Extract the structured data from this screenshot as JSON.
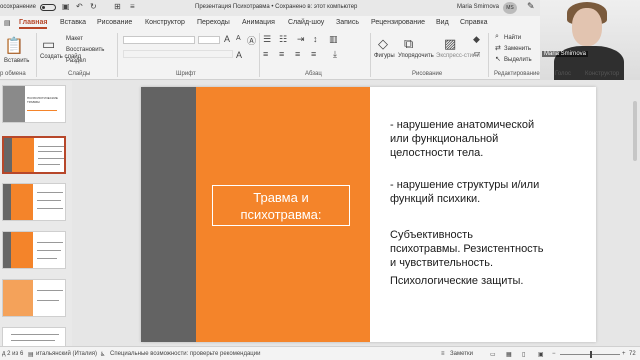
{
  "titlebar": {
    "autosave": "осохранение",
    "title": "Презентация Психотравма • Сохранено в: этот компьютер",
    "user_name": "Maria Smirnova",
    "user_initials": "MS"
  },
  "tabs": [
    "Главная",
    "Вставка",
    "Рисование",
    "Конструктор",
    "Переходы",
    "Анимация",
    "Слайд-шоу",
    "Запись",
    "Рецензирование",
    "Вид",
    "Справка"
  ],
  "ribbon": {
    "paste_label": "Вставить",
    "clipboard_label": "р обмена",
    "new_slide": "Создать слайд",
    "layout": "Макет",
    "reset": "Восстановить",
    "section": "Раздел",
    "slides_group": "Слайды",
    "font_group": "Шрифт",
    "paragraph_group": "Абзац",
    "shapes": "Фигуры",
    "arrange": "Упорядочить",
    "express": "Экспресс-стили",
    "drawing_group": "Рисование",
    "find": "Найти",
    "replace": "Заменить",
    "select": "Выделить",
    "editing_group": "Редактирование",
    "voice_group": "Голос",
    "designer_group": "Конструктор"
  },
  "video": {
    "name": "Maria Smirnova"
  },
  "thumbnails": {
    "slide1_title": "ПСИХОЛОГИЧЕСКИЕ ТРАВМЫ"
  },
  "slide": {
    "title_line1": "Травма и",
    "title_line2": "психотравма:",
    "p1_line1": "- нарушение анатомической",
    "p1_line2": "или функциональной",
    "p1_line3": "целостности тела.",
    "p2_line1": "- нарушение структуры и/или",
    "p2_line2": "функций психики.",
    "p3_line1": "Субъективность",
    "p3_line2": "психотравмы. Резистентность",
    "p3_line3": "и чувствительность.",
    "p4": "Психологические защиты."
  },
  "status": {
    "slide_count": "д 2 из 6",
    "language": "итальянский (Италия)",
    "accessibility": "Специальные возможности: проверьте рекомендации",
    "notes": "Заметки",
    "zoom": "72"
  },
  "colors": {
    "accent": "#b7472a",
    "orange": "#f4842a",
    "gray": "#636363"
  }
}
